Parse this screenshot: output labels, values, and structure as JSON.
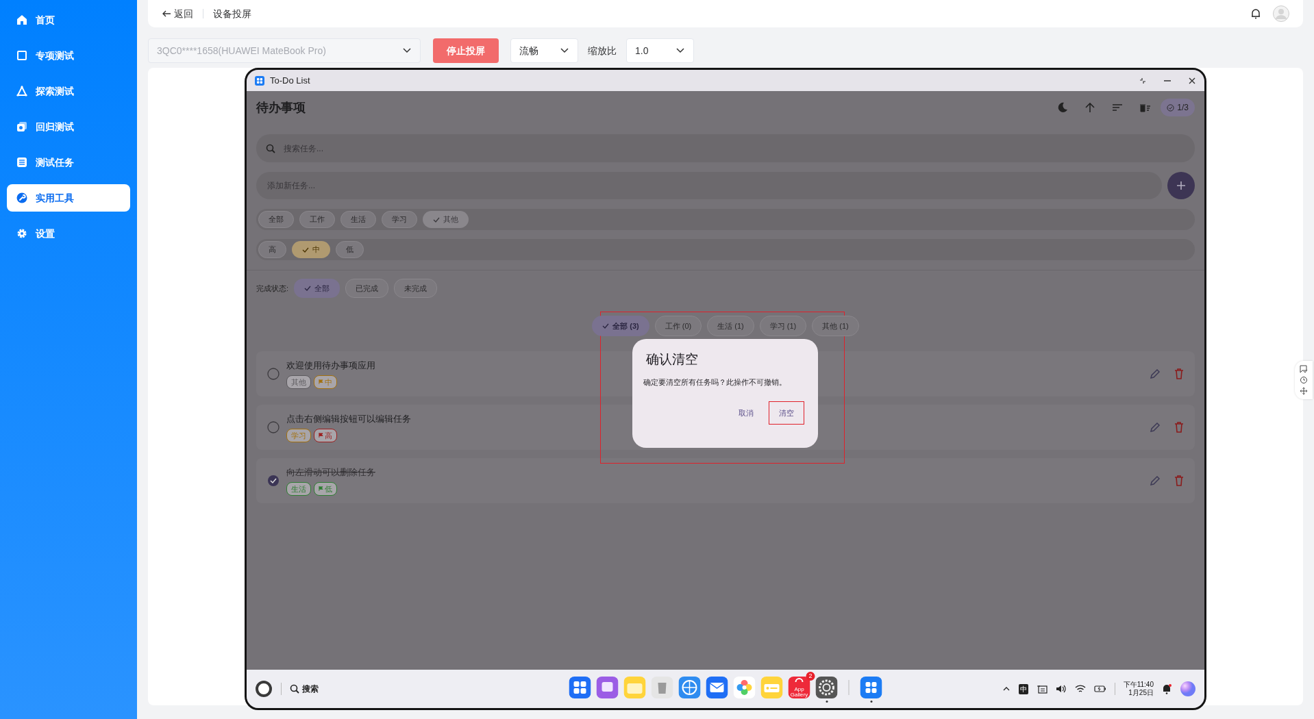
{
  "sidebar": {
    "items": [
      {
        "label": "首页",
        "kind": "home",
        "selected": false
      },
      {
        "label": "专项测试",
        "kind": "chip",
        "selected": false
      },
      {
        "label": "探索测试",
        "kind": "explore",
        "selected": false
      },
      {
        "label": "回归测试",
        "kind": "regress",
        "selected": false
      },
      {
        "label": "测试任务",
        "kind": "list",
        "selected": false
      },
      {
        "label": "实用工具",
        "kind": "tool",
        "selected": true
      },
      {
        "label": "设置",
        "kind": "gear",
        "selected": false
      }
    ]
  },
  "topbar": {
    "back": "返回",
    "title": "设备投屏"
  },
  "toolbar": {
    "device": "3QC0****1658(HUAWEI MateBook Pro)",
    "stop_button": "停止投屏",
    "quality": "流畅",
    "scale_label": "缩放比",
    "scale": "1.0"
  },
  "device_window": {
    "title": "To-Do List",
    "app": {
      "title": "待办事项",
      "progress": "1/3",
      "search_placeholder": "搜索任务...",
      "add_placeholder": "添加新任务...",
      "categories": [
        {
          "label": "全部",
          "selected": false
        },
        {
          "label": "工作",
          "selected": false
        },
        {
          "label": "生活",
          "selected": false
        },
        {
          "label": "学习",
          "selected": false
        },
        {
          "label": "其他",
          "selected": true
        }
      ],
      "priorities": [
        {
          "label": "高",
          "selected": false
        },
        {
          "label": "中",
          "selected": true
        },
        {
          "label": "低",
          "selected": false
        }
      ],
      "status_label": "完成状态:",
      "status_filters": [
        {
          "label": "全部",
          "selected": true
        },
        {
          "label": "已完成",
          "selected": false
        },
        {
          "label": "未完成",
          "selected": false
        }
      ],
      "tabs": [
        {
          "label": "全部 (3)",
          "selected": true
        },
        {
          "label": "工作 (0)",
          "selected": false
        },
        {
          "label": "生活 (1)",
          "selected": false
        },
        {
          "label": "学习 (1)",
          "selected": false
        },
        {
          "label": "其他 (1)",
          "selected": false
        }
      ],
      "tasks": [
        {
          "title": "欢迎使用待办事项应用",
          "done": false,
          "tags": [
            {
              "label": "其他",
              "kind": "category",
              "color": "#5c5a5e"
            },
            {
              "label": "中",
              "kind": "priority",
              "color": "#a3700e"
            }
          ]
        },
        {
          "title": "点击右侧编辑按钮可以编辑任务",
          "done": false,
          "tags": [
            {
              "label": "学习",
              "kind": "category",
              "color": "#a3700e"
            },
            {
              "label": "高",
              "kind": "priority",
              "color": "#9d1f1f"
            }
          ]
        },
        {
          "title": "向左滑动可以删除任务",
          "done": true,
          "tags": [
            {
              "label": "生活",
              "kind": "category",
              "color": "#2e7d32"
            },
            {
              "label": "低",
              "kind": "priority",
              "color": "#2e7d32"
            }
          ]
        }
      ],
      "dialog": {
        "title": "确认清空",
        "message": "确定要清空所有任务吗？此操作不可撤销。",
        "cancel": "取消",
        "confirm": "清空",
        "highlighted": true,
        "confirm_highlighted": true
      }
    },
    "taskbar": {
      "search": "搜索",
      "dock": [
        {
          "kind": "grid",
          "running": false
        },
        {
          "kind": "window",
          "running": false
        },
        {
          "kind": "folder",
          "running": false
        },
        {
          "kind": "trash",
          "running": false
        },
        {
          "kind": "globe",
          "running": false
        },
        {
          "kind": "mail",
          "running": false
        },
        {
          "kind": "flower",
          "running": false
        },
        {
          "kind": "notes",
          "running": false
        },
        {
          "kind": "store",
          "running": false,
          "label": "App Gallery",
          "badge": "2"
        },
        {
          "kind": "settings",
          "running": true
        }
      ],
      "pinned": [
        {
          "kind": "todo",
          "running": true
        }
      ],
      "ime": "中",
      "time": "下午11:40",
      "date": "1月25日"
    }
  }
}
